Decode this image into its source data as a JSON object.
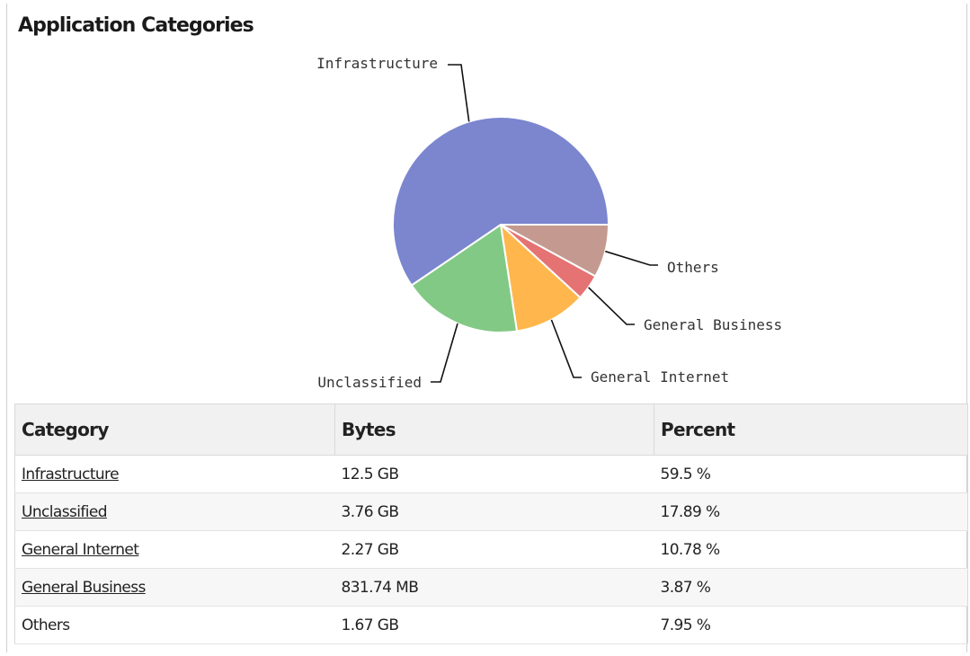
{
  "panel": {
    "title": "Application Categories"
  },
  "table": {
    "headers": [
      "Category",
      "Bytes",
      "Percent"
    ],
    "rows": [
      {
        "category": "Infrastructure",
        "bytes": "12.5 GB",
        "percent": "59.5 %",
        "link": true
      },
      {
        "category": "Unclassified",
        "bytes": "3.76 GB",
        "percent": "17.89 %",
        "link": true
      },
      {
        "category": "General Internet",
        "bytes": "2.27 GB",
        "percent": "10.78 %",
        "link": true
      },
      {
        "category": "General Business",
        "bytes": "831.74 MB",
        "percent": "3.87 %",
        "link": true
      },
      {
        "category": "Others",
        "bytes": "1.67 GB",
        "percent": "7.95 %",
        "link": false
      }
    ]
  },
  "chart_data": {
    "type": "pie",
    "title": "Application Categories",
    "categories": [
      "Infrastructure",
      "Unclassified",
      "General Internet",
      "General Business",
      "Others"
    ],
    "values": [
      59.5,
      17.89,
      10.78,
      3.87,
      7.95
    ],
    "colors": [
      "#7b86cf",
      "#82c985",
      "#ffb74d",
      "#e57373",
      "#c49a90"
    ],
    "labels_as_callouts": true
  }
}
